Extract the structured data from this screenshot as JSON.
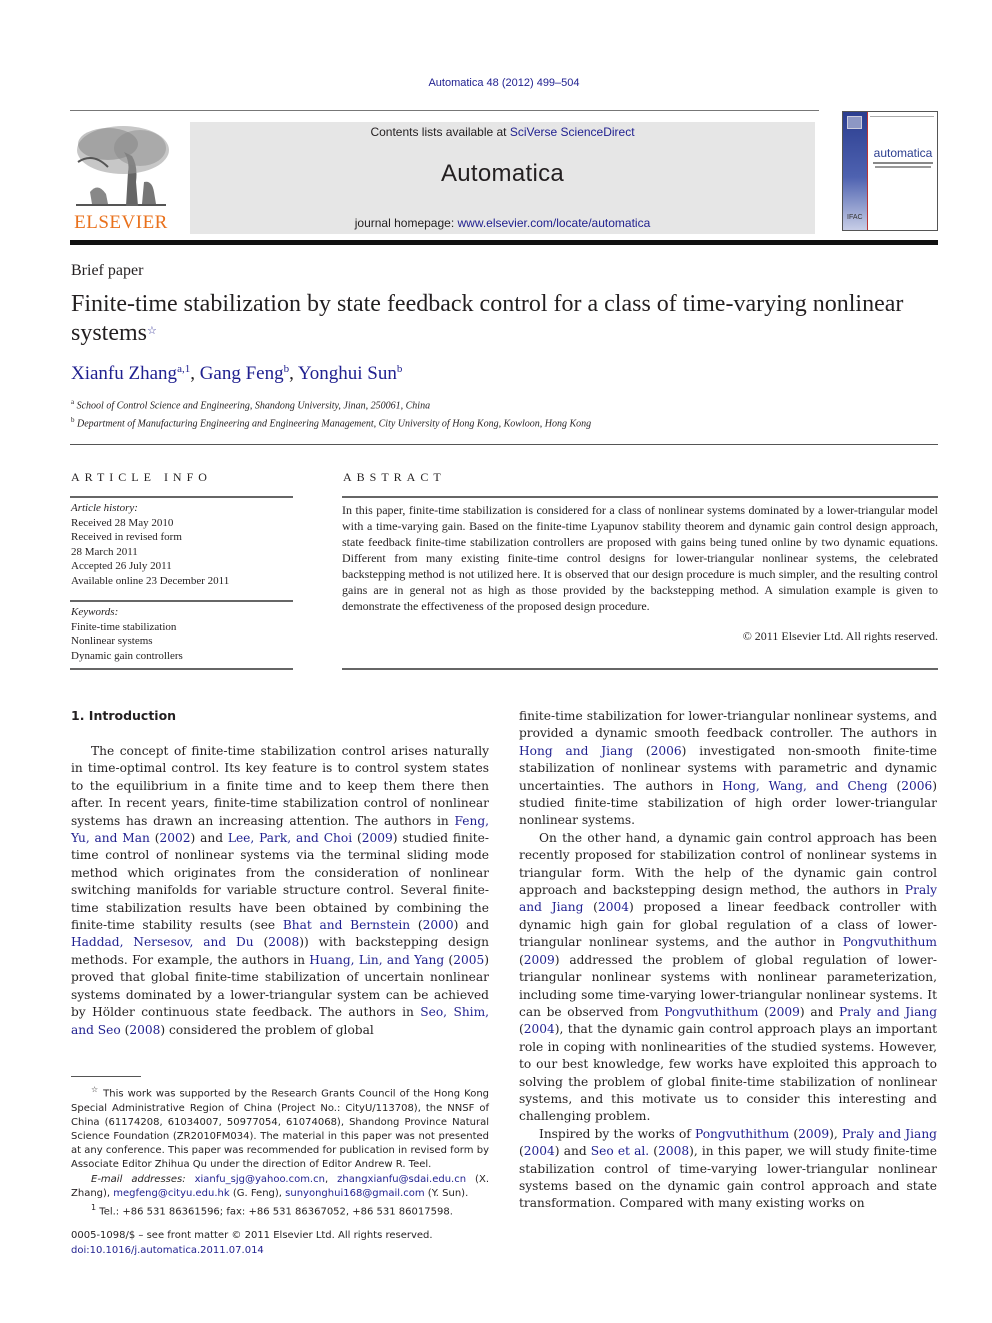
{
  "header": {
    "citation": "Automatica 48 (2012) 499–504",
    "contents_prefix": "Contents lists available at ",
    "contents_link": "SciVerse ScienceDirect",
    "journal_name": "Automatica",
    "homepage_prefix": "journal homepage: ",
    "homepage_link": "www.elsevier.com/locate/automatica",
    "publisher_logo_text": "ELSEVIER",
    "cover_title": "automatica",
    "colors": {
      "link": "#1f1f8f",
      "publisher_orange": "#e9711c",
      "masthead_bg": "#e6e6e6"
    }
  },
  "article": {
    "type": "Brief paper",
    "title": "Finite-time stabilization by state feedback control for a class of time-varying nonlinear systems",
    "title_marker": "☆",
    "authors": [
      {
        "name": "Xianfu Zhang",
        "sup": "a,1"
      },
      {
        "name": "Gang Feng",
        "sup": "b"
      },
      {
        "name": "Yonghui Sun",
        "sup": "b"
      }
    ],
    "author_sep": ", ",
    "affiliations": [
      {
        "sup": "a",
        "text": "School of Control Science and Engineering, Shandong University, Jinan, 250061, China"
      },
      {
        "sup": "b",
        "text": "Department of Manufacturing Engineering and Engineering Management, City University of Hong Kong, Kowloon, Hong Kong"
      }
    ]
  },
  "article_info": {
    "heading": "ARTICLE INFO",
    "history_label": "Article history:",
    "history": [
      "Received 28 May 2010",
      "Received in revised form",
      "28 March 2011",
      "Accepted 26 July 2011",
      "Available online 23 December 2011"
    ],
    "keywords_label": "Keywords:",
    "keywords": [
      "Finite-time stabilization",
      "Nonlinear systems",
      "Dynamic gain controllers"
    ]
  },
  "abstract": {
    "heading": "ABSTRACT",
    "text": "In this paper, finite-time stabilization is considered for a class of nonlinear systems dominated by a lower-triangular model with a time-varying gain. Based on the finite-time Lyapunov stability theorem and dynamic gain control design approach, state feedback finite-time stabilization controllers are proposed with gains being tuned online by two dynamic equations. Different from many existing finite-time control designs for lower-triangular nonlinear systems, the celebrated backstepping method is not utilized here. It is observed that our design procedure is much simpler, and the resulting control gains are in general not as high as those provided by the backstepping method. A simulation example is given to demonstrate the effectiveness of the proposed design procedure.",
    "copyright": "© 2011 Elsevier Ltd. All rights reserved."
  },
  "introduction": {
    "heading": "1.  Introduction",
    "left_p1": [
      {
        "t": "The concept of finite-time stabilization control arises naturally in time-optimal control. Its key feature is to control system states to the equilibrium in a finite time and to keep them there then after. In recent years, finite-time stabilization control of nonlinear systems has drawn an increasing attention. The authors in "
      },
      {
        "link": "Feng, Yu, and Man"
      },
      {
        "t": " ("
      },
      {
        "link": "2002"
      },
      {
        "t": ") and "
      },
      {
        "link": "Lee, Park, and Choi"
      },
      {
        "t": " ("
      },
      {
        "link": "2009"
      },
      {
        "t": ") studied finite-time control of nonlinear systems via the terminal sliding mode method which originates from the consideration of nonlinear switching manifolds for variable structure control. Several finite-time stabilization results have been obtained by combining the finite-time stability results (see "
      },
      {
        "link": "Bhat and Bernstein"
      },
      {
        "t": " ("
      },
      {
        "link": "2000"
      },
      {
        "t": ") and "
      },
      {
        "link": "Haddad, Nersesov, and Du"
      },
      {
        "t": " ("
      },
      {
        "link": "2008"
      },
      {
        "t": ")) with backstepping design methods. For example, the authors in "
      },
      {
        "link": "Huang, Lin, and Yang"
      },
      {
        "t": " ("
      },
      {
        "link": "2005"
      },
      {
        "t": ") proved that global finite-time stabilization of uncertain nonlinear systems dominated by a lower-triangular system can be achieved by Hölder continuous state feedback. The authors in "
      },
      {
        "link": "Seo, Shim, and Seo"
      },
      {
        "t": " ("
      },
      {
        "link": "2008"
      },
      {
        "t": ") considered the problem of global"
      }
    ],
    "right_p1": [
      {
        "t": "finite-time stabilization for lower-triangular nonlinear systems, and provided a dynamic smooth feedback controller. The authors in "
      },
      {
        "link": "Hong and Jiang"
      },
      {
        "t": " ("
      },
      {
        "link": "2006"
      },
      {
        "t": ") investigated non-smooth finite-time stabilization of nonlinear systems with parametric and dynamic uncertainties. The authors in "
      },
      {
        "link": "Hong, Wang, and Cheng"
      },
      {
        "t": " ("
      },
      {
        "link": "2006"
      },
      {
        "t": ") studied finite-time stabilization of high order lower-triangular nonlinear systems."
      }
    ],
    "right_p2": [
      {
        "t": "On the other hand, a dynamic gain control approach has been recently proposed for stabilization control of nonlinear systems in triangular form. With the help of the dynamic gain control approach and backstepping design method, the authors in "
      },
      {
        "link": "Praly and Jiang"
      },
      {
        "t": " ("
      },
      {
        "link": "2004"
      },
      {
        "t": ") proposed a linear feedback controller with dynamic high gain for global regulation of a class of lower-triangular nonlinear systems, and the author in "
      },
      {
        "link": "Pongvuthithum"
      },
      {
        "t": " ("
      },
      {
        "link": "2009"
      },
      {
        "t": ") addressed the problem of global regulation of lower-triangular nonlinear systems with nonlinear parameterization, including some time-varying lower-triangular nonlinear systems. It can be observed from "
      },
      {
        "link": "Pongvuthithum"
      },
      {
        "t": " ("
      },
      {
        "link": "2009"
      },
      {
        "t": ") and "
      },
      {
        "link": "Praly and Jiang"
      },
      {
        "t": " ("
      },
      {
        "link": "2004"
      },
      {
        "t": "), that the dynamic gain control approach plays an important role in coping with nonlinearities of the studied systems. However, to our best knowledge, few works have exploited this approach to solving the problem of global finite-time stabilization of nonlinear systems, and this motivate us to consider this interesting and challenging problem."
      }
    ],
    "right_p3": [
      {
        "t": "Inspired by the works of "
      },
      {
        "link": "Pongvuthithum"
      },
      {
        "t": " ("
      },
      {
        "link": "2009"
      },
      {
        "t": "), "
      },
      {
        "link": "Praly and Jiang"
      },
      {
        "t": " ("
      },
      {
        "link": "2004"
      },
      {
        "t": ") and "
      },
      {
        "link": "Seo et al."
      },
      {
        "t": " ("
      },
      {
        "link": "2008"
      },
      {
        "t": "), in this paper, we will study finite-time stabilization control of time-varying lower-triangular nonlinear systems based on the dynamic gain control approach and state transformation. Compared with many existing works on"
      }
    ]
  },
  "footnotes": {
    "funding_marker": "☆",
    "funding": " This work was supported by the Research Grants Council of the Hong Kong Special Administrative Region of China (Project No.: CityU/113708), the NNSF of China (61174208, 61034007, 50977054, 61074068), Shandong Province Natural Science Foundation (ZR2010FM034). The material in this paper was not presented at any conference. This paper was recommended for publication in revised form by Associate Editor Zhihua Qu under the direction of Editor Andrew R. Teel.",
    "email_label": "E-mail addresses:",
    "emails": [
      {
        "addr": "xianfu_sjg@yahoo.com.cn",
        "after": ", "
      },
      {
        "addr": "zhangxianfu@sdai.edu.cn",
        "after": " (X. Zhang), "
      },
      {
        "addr": "megfeng@cityu.edu.hk",
        "after": " (G. Feng), "
      },
      {
        "addr": "sunyonghui168@gmail.com",
        "after": " (Y. Sun)."
      }
    ],
    "tel_marker": "1",
    "tel": "Tel.: +86 531 86361596; fax: +86 531 86367052, +86 531 86017598.",
    "issn_line": "0005-1098/$ – see front matter © 2011 Elsevier Ltd. All rights reserved.",
    "doi": "doi:10.1016/j.automatica.2011.07.014"
  }
}
